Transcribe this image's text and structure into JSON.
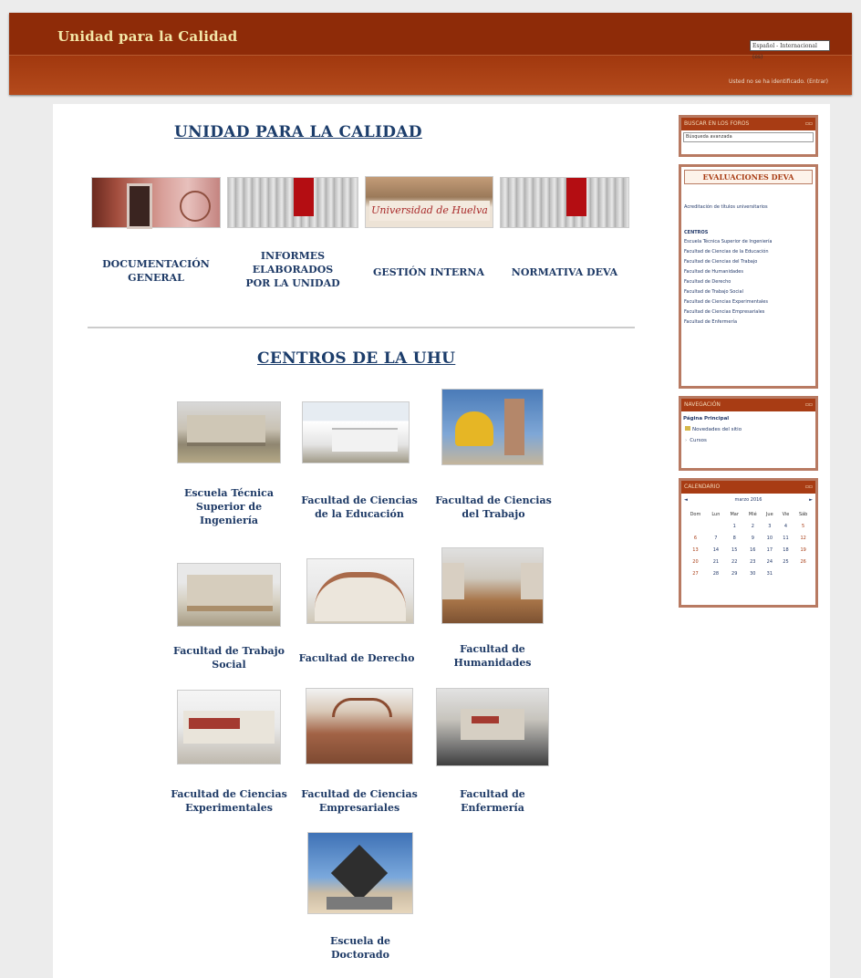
{
  "header": {
    "site_title": "Unidad para la Calidad",
    "language_select": "Español - Internacional (es)",
    "login_info": "Usted no se ha identificado. (Entrar)"
  },
  "main": {
    "title": "UNIDAD PARA LA CALIDAD",
    "sections": [
      {
        "label": "DOCUMENTACIÓN GENERAL"
      },
      {
        "label": "INFORMES ELABORADOS POR LA UNIDAD"
      },
      {
        "label": "GESTIÓN INTERNA"
      },
      {
        "label": "NORMATIVA DEVA"
      }
    ],
    "centers_title": "CENTROS  DE LA UHU",
    "centers": [
      {
        "label": "Escuela Técnica Superior de Ingeniería"
      },
      {
        "label": "Facultad  de Ciencias de la Educación"
      },
      {
        "label": "Facultad de Ciencias del Trabajo"
      },
      {
        "label": "Facultad de Trabajo Social"
      },
      {
        "label": "Facultad de Derecho"
      },
      {
        "label": "Facultad de Humanidades"
      },
      {
        "label": "Facultad de Ciencias Experimentales"
      },
      {
        "label": "Facultad  de Ciencias Empresariales"
      },
      {
        "label": "Facultad de Enfermería"
      },
      {
        "label": "Escuela de Doctorado"
      }
    ],
    "banner_text": "Universidad de Huelva"
  },
  "sidebar": {
    "block_search": {
      "title": "BUSCAR EN LOS FOROS",
      "input": "Búsqueda avanzada"
    },
    "block_deva": {
      "title": "EVALUACIONES DEVA",
      "link": "Acreditación de títulos universitarios",
      "heading": "CENTROS",
      "items": [
        "Escuela Técnica Superior de Ingeniería",
        "Facultad de Ciencias de la Educación",
        "Facultad de Ciencias del Trabajo",
        "Facultad de Humanidades",
        "Facultad de Derecho",
        "Facultad de Trabajo Social",
        "Facultad de Ciencias Experimentales",
        "Facultad de Ciencias Empresariales",
        "Facultad de Enfermería"
      ]
    },
    "block_nav": {
      "title": "NAVEGACIÓN",
      "items": [
        "Página Principal",
        "Novedades del sitio",
        "Cursos"
      ]
    },
    "block_calendar": {
      "title": "CALENDARIO",
      "month": "marzo 2016",
      "prev": "◄",
      "next": "►",
      "weekdays": [
        "Dom",
        "Lun",
        "Mar",
        "Mié",
        "Jue",
        "Vie",
        "Sáb"
      ],
      "days": [
        [
          "",
          "",
          "1",
          "2",
          "3",
          "4",
          "5"
        ],
        [
          "6",
          "7",
          "8",
          "9",
          "10",
          "11",
          "12"
        ],
        [
          "13",
          "14",
          "15",
          "16",
          "17",
          "18",
          "19"
        ],
        [
          "20",
          "21",
          "22",
          "23",
          "24",
          "25",
          "26"
        ],
        [
          "27",
          "28",
          "29",
          "30",
          "31",
          "",
          ""
        ]
      ]
    }
  },
  "colors": {
    "header": "#8e2b08",
    "title_text": "#1c3d6b",
    "block_border": "#b87a62",
    "site_title": "#f3e6a7"
  }
}
